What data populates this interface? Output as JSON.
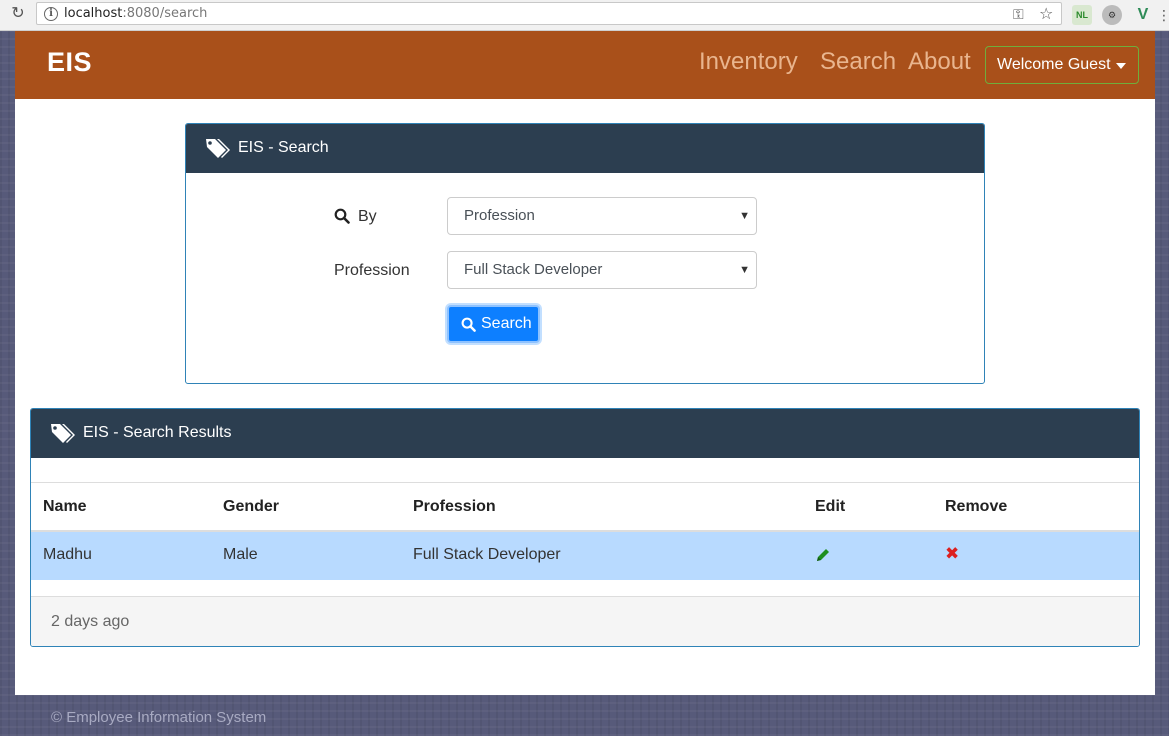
{
  "browser": {
    "url_host": "localhost",
    "url_rest": ":8080/search"
  },
  "navbar": {
    "brand": "EIS",
    "links": [
      "Inventory",
      "Search",
      "About"
    ],
    "user_button": "Welcome Guest"
  },
  "search_panel": {
    "title": "EIS - Search",
    "by_label": "By",
    "by_value": "Profession",
    "profession_label": "Profession",
    "profession_value": "Full Stack Developer",
    "search_button": "Search"
  },
  "results_panel": {
    "title": "EIS - Search Results",
    "columns": [
      "Name",
      "Gender",
      "Profession",
      "Edit",
      "Remove"
    ],
    "rows": [
      {
        "name": "Madhu",
        "gender": "Male",
        "profession": "Full Stack Developer"
      }
    ],
    "footer": "2 days ago"
  },
  "footer": {
    "text": "© Employee Information System"
  },
  "colors": {
    "navbar": "#a9501a",
    "panel_header": "#2c3e50",
    "primary_button": "#0d7fff",
    "selected_row": "#b8daff"
  }
}
